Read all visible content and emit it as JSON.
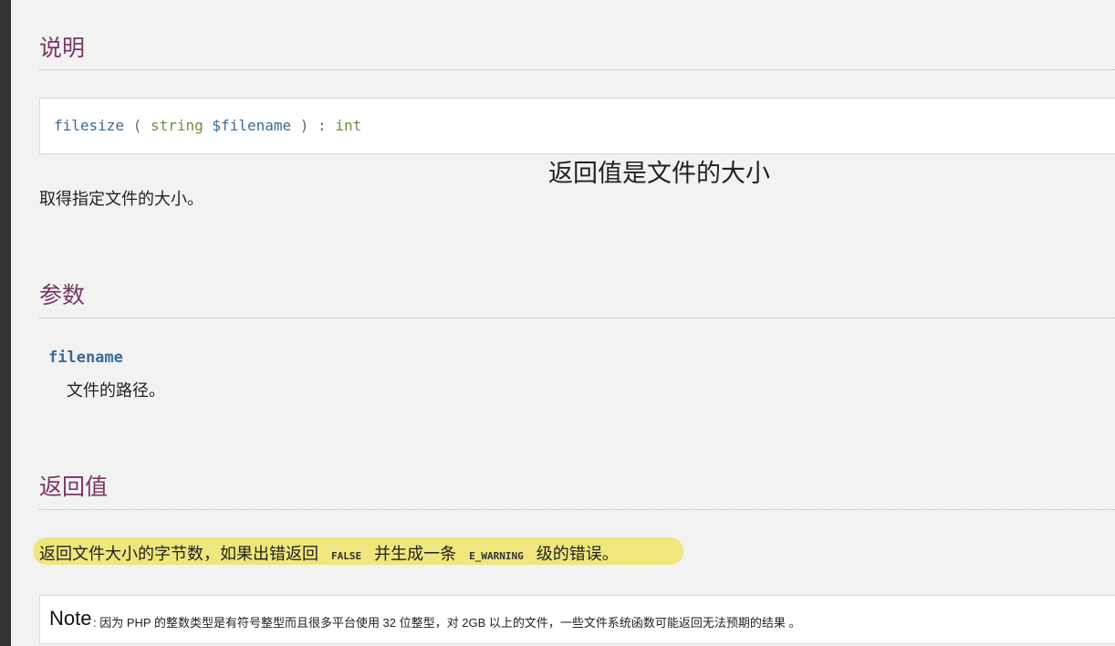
{
  "sections": {
    "description_title": "说明",
    "parameters_title": "参数",
    "return_title": "返回值"
  },
  "signature": {
    "function_name": "filesize",
    "open_paren": "(",
    "param_type": "string",
    "param_name": "$filename",
    "close_paren": ")",
    "colon": ":",
    "return_type": "int"
  },
  "annotation": "返回值是文件的大小",
  "description": "取得指定文件的大小。",
  "parameter": {
    "name": "filename",
    "desc": "文件的路径。"
  },
  "return_value": {
    "text_before": "返回文件大小的字节数，如果出错返回",
    "false_const": "FALSE",
    "text_middle": "并生成一条",
    "warning_const": "E_WARNING",
    "text_after": "级的错误。"
  },
  "note": {
    "label": "Note",
    "text": ": 因为 PHP 的整数类型是有符号整型而且很多平台使用 32 位整型，对 2GB 以上的文件，一些文件系统函数可能返回无法预期的结果 。"
  },
  "colors": {
    "heading": "#793862",
    "code_blue": "#3a6b95",
    "code_green": "#6d8e43",
    "highlight": "#efe67d"
  }
}
